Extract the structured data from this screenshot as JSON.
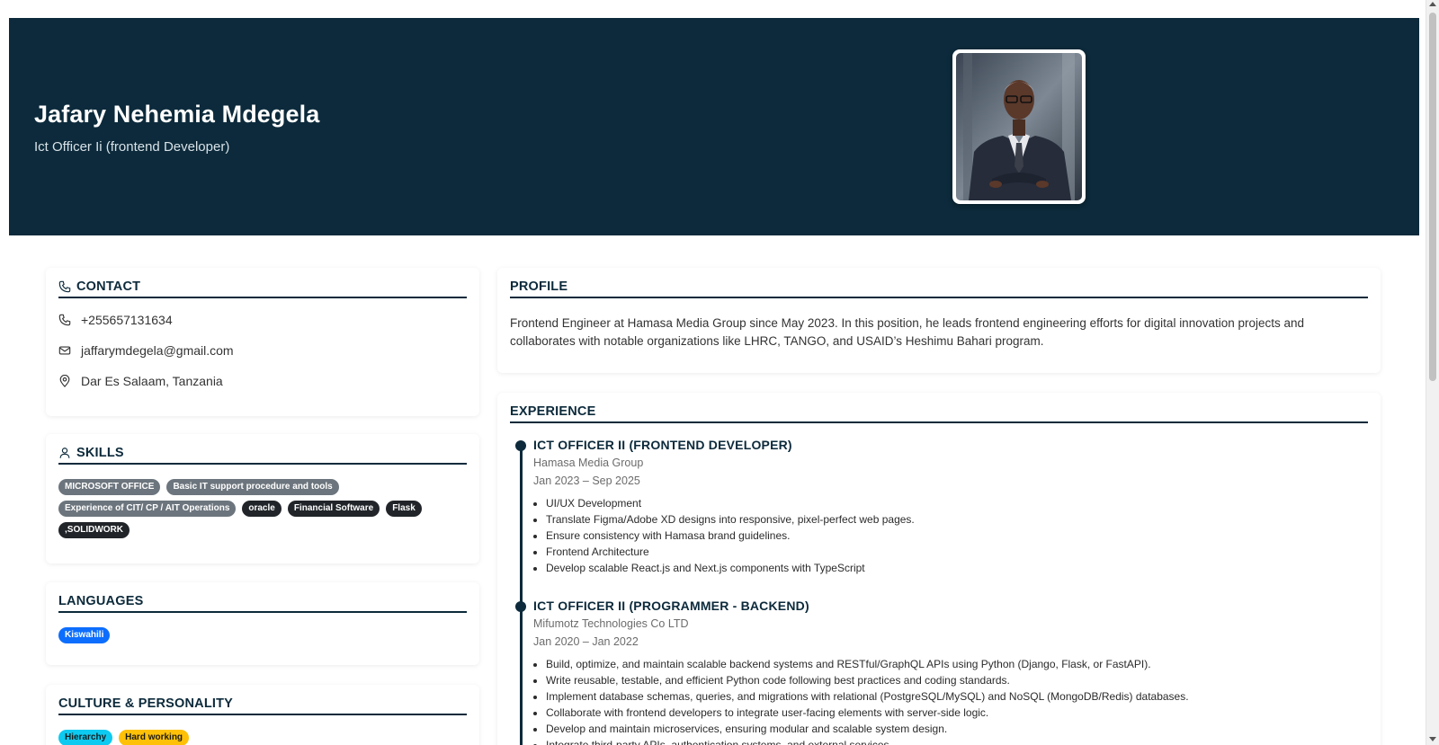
{
  "header": {
    "name": "Jafary Nehemia Mdegela",
    "title": "Ict Officer Ii (frontend Developer)",
    "photo_alt": "Profile photo"
  },
  "contact": {
    "heading": "CONTACT",
    "phone": "+255657131634",
    "email": "jaffarymdegela@gmail.com",
    "location": "Dar Es Salaam, Tanzania"
  },
  "skills": {
    "heading": "SKILLS",
    "items": [
      {
        "label": "MICROSOFT OFFICE",
        "style": "gray"
      },
      {
        "label": "Basic IT support procedure and tools",
        "style": "gray"
      },
      {
        "label": "Experience of CIT/ CP / AIT Operations",
        "style": "gray"
      },
      {
        "label": "oracle",
        "style": "dark"
      },
      {
        "label": "Financial Software",
        "style": "dark"
      },
      {
        "label": "Flask",
        "style": "dark"
      },
      {
        "label": ",SOLIDWORK",
        "style": "dark"
      }
    ]
  },
  "languages": {
    "heading": "LANGUAGES",
    "items": [
      {
        "label": "Kiswahili",
        "style": "blue"
      }
    ]
  },
  "culture": {
    "heading": "CULTURE & PERSONALITY",
    "items": [
      {
        "label": "Hierarchy",
        "style": "cyan"
      },
      {
        "label": "Hard working",
        "style": "yellow"
      }
    ]
  },
  "profile": {
    "heading": "PROFILE",
    "text": "Frontend Engineer at Hamasa Media Group since May 2023. In this position, he leads frontend engineering efforts for digital innovation projects and collaborates with notable organizations like LHRC, TANGO, and USAID’s Heshimu Bahari program."
  },
  "experience": {
    "heading": "EXPERIENCE",
    "jobs": [
      {
        "title": "ICT OFFICER II (FRONTEND DEVELOPER)",
        "company": "Hamasa Media Group",
        "dates": "Jan 2023 – Sep 2025",
        "bullets": [
          "UI/UX Development",
          "Translate Figma/Adobe XD designs into responsive, pixel-perfect web pages.",
          "Ensure consistency with Hamasa brand guidelines.",
          "Frontend Architecture",
          "Develop scalable React.js and Next.js components with TypeScript"
        ]
      },
      {
        "title": "ICT OFFICER II (PROGRAMMER - BACKEND)",
        "company": "Mifumotz Technologies Co LTD",
        "dates": "Jan 2020 – Jan 2022",
        "bullets": [
          "Build, optimize, and maintain scalable backend systems and RESTful/GraphQL APIs using Python (Django, Flask, or FastAPI).",
          "Write reusable, testable, and efficient Python code following best practices and coding standards.",
          "Implement database schemas, queries, and migrations with relational (PostgreSQL/MySQL) and NoSQL (MongoDB/Redis) databases.",
          "Collaborate with frontend developers to integrate user-facing elements with server-side logic.",
          "Develop and maintain microservices, ensuring modular and scalable system design.",
          "Integrate third-party APIs, authentication systems, and external services."
        ]
      }
    ]
  },
  "colors": {
    "header_bg": "#0c2a3b",
    "accent": "#0c2a3b"
  }
}
